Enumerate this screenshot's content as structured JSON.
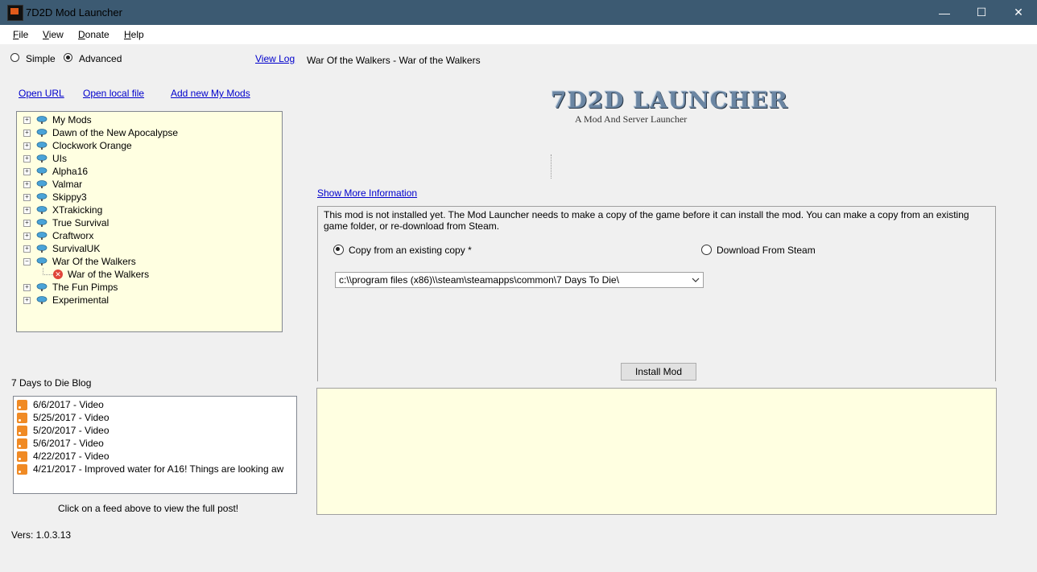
{
  "window": {
    "title": "7D2D Mod Launcher",
    "minimize_glyph": "—",
    "maximize_glyph": "☐",
    "close_glyph": "✕"
  },
  "menu": [
    "File",
    "View",
    "Donate",
    "Help"
  ],
  "mode": {
    "simple_label": "Simple",
    "advanced_label": "Advanced",
    "selected": "Advanced"
  },
  "view_log": "View Log",
  "selected_mod_title": "War Of the Walkers - War of the Walkers",
  "links": {
    "open_url": "Open URL",
    "open_local": "Open local file",
    "add_new": "Add new My Mods"
  },
  "tree": {
    "items": [
      "My Mods",
      "Dawn of the New Apocalypse",
      "Clockwork Orange",
      "UIs",
      "Alpha16",
      "Valmar",
      "Skippy3",
      "XTrakicking",
      "True Survival",
      "Craftworx",
      "SurvivalUK",
      "War Of the Walkers",
      "War of the Walkers",
      "The Fun Pimps",
      "Experimental"
    ]
  },
  "blog": {
    "heading": "7 Days to Die Blog",
    "items": [
      "6/6/2017 - Video",
      "5/25/2017 - Video",
      "5/20/2017 - Video",
      "5/6/2017 - Video",
      "4/22/2017 - Video",
      "4/21/2017 - Improved water for A16!  Things are looking aw"
    ],
    "hint": "Click on a feed above to view the full post!"
  },
  "version": "Vers: 1.0.3.13",
  "logo": {
    "title": "7D2D LAUNCHER",
    "subtitle": "A Mod And Server Launcher"
  },
  "show_more": "Show More Information",
  "install": {
    "message": "This mod is not installed yet. The Mod Launcher needs to make a copy of the game before it can install the mod. You can make a copy from an existing game folder, or re-download from Steam.",
    "copy_label": "Copy from an existing copy *",
    "steam_label": "Download From Steam",
    "selected": "copy",
    "path_value": "c:\\\\program files (x86)\\\\steam\\steamapps\\common\\7 Days To Die\\",
    "button_label": "Install Mod"
  }
}
